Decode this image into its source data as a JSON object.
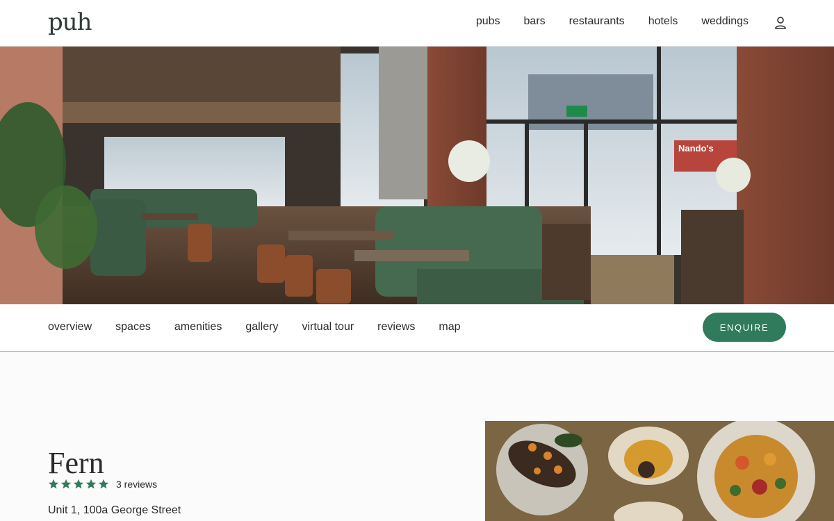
{
  "header": {
    "logo": "puh",
    "nav": [
      "pubs",
      "bars",
      "restaurants",
      "hotels",
      "weddings"
    ],
    "account_icon": "user-icon"
  },
  "hero": {
    "description_icon": "restaurant-interior-photo",
    "sign_text": "Nando's"
  },
  "subnav": {
    "items": [
      "overview",
      "spaces",
      "amenities",
      "gallery",
      "virtual tour",
      "reviews",
      "map"
    ],
    "enquire_label": "ENQUIRE"
  },
  "venue": {
    "name": "Fern",
    "rating": 5,
    "reviews_label": "3 reviews",
    "address": "Unit 1, 100a George Street"
  },
  "colors": {
    "accent": "#2f7b5c",
    "text": "#2b2b2b"
  }
}
